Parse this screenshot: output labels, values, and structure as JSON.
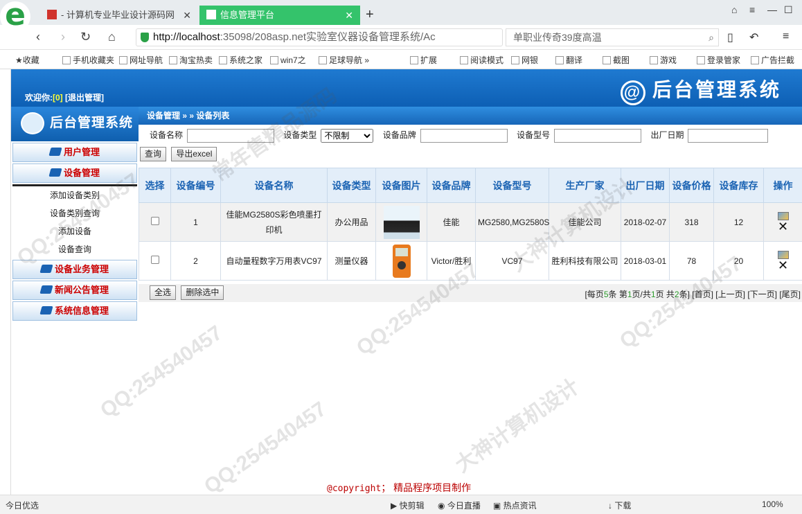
{
  "browser": {
    "tab1_title": "- 计算机专业毕业设计源码网",
    "tab2_title": "信息管理平台",
    "url_host": "http://localhost",
    "url_rest": ":35098/208asp.net实验室仪器设备管理系统/Ac",
    "search_text": "单职业传奇39度高温",
    "bookmarks": [
      "收藏",
      "手机收藏夹",
      "网址导航",
      "淘宝热卖",
      "系统之家",
      "win7之",
      "足球导航",
      "扩展",
      "阅读模式",
      "网银",
      "翻译",
      "截图",
      "游戏",
      "登录管家",
      "广告拦截"
    ],
    "status_left": "今日优选",
    "status_items": [
      "快剪辑",
      "今日直播",
      "热点资讯",
      "下载"
    ],
    "zoom": "100%"
  },
  "header": {
    "welcome": "欢迎你:",
    "user": "[0]",
    "logout": "[退出管理]",
    "brand": "后台管理系统"
  },
  "sidebar": {
    "logo": "后台管理系统",
    "menu_user": "用户管理",
    "menu_device": "设备管理",
    "sub_items": [
      "添加设备类别",
      "设备类别查询",
      "添加设备",
      "设备查询"
    ],
    "menu_business": "设备业务管理",
    "menu_news": "新闻公告管理",
    "menu_system": "系统信息管理"
  },
  "main": {
    "breadcrumb": "设备管理 » » 设备列表",
    "filter": {
      "name_label": "设备名称",
      "type_label": "设备类型",
      "type_value": "不限制",
      "brand_label": "设备品牌",
      "model_label": "设备型号",
      "date_label": "出厂日期"
    },
    "btn_query": "查询",
    "btn_export": "导出excel",
    "columns": [
      "选择",
      "设备编号",
      "设备名称",
      "设备类型",
      "设备图片",
      "设备品牌",
      "设备型号",
      "生产厂家",
      "出厂日期",
      "设备价格",
      "设备库存",
      "操作"
    ],
    "rows": [
      {
        "id": "1",
        "name": "佳能MG2580S彩色喷墨打印机",
        "type": "办公用品",
        "brand": "佳能",
        "model": "MG2580,MG2580S",
        "maker": "佳能公司",
        "date": "2018-02-07",
        "price": "318",
        "stock": "12"
      },
      {
        "id": "2",
        "name": "自动量程数字万用表VC97",
        "type": "测量仪器",
        "brand": "Victor/胜利",
        "model": "VC97",
        "maker": "胜利科技有限公司",
        "date": "2018-03-01",
        "price": "78",
        "stock": "20"
      }
    ],
    "btn_select_all": "全选",
    "btn_delete": "删除选中",
    "pager": {
      "p1": "[每页",
      "per": "5",
      "p2": "条 第",
      "cur": "1",
      "p3": "页/共",
      "total": "1",
      "p4": "页 共",
      "count": "2",
      "p5": "条]",
      "first": "[首页]",
      "prev": "[上一页]",
      "next": "[下一页]",
      "last": "[尾页]"
    }
  },
  "footer": {
    "copy": "@copyright",
    "rest": "； 精品程序项目制作"
  },
  "watermarks": [
    "QQ:254540457",
    "大神计算机设计",
    "常年售精品源码"
  ]
}
